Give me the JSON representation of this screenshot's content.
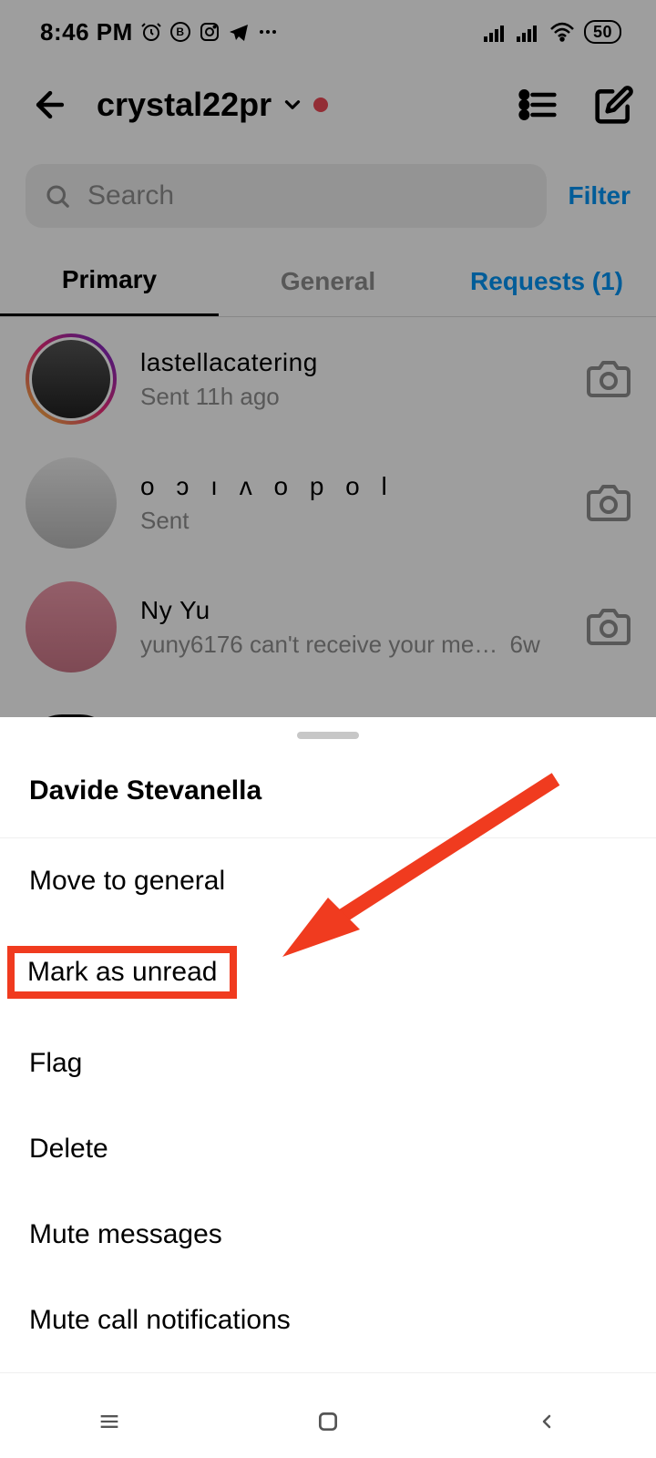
{
  "status": {
    "time": "8:46 PM",
    "battery": "50"
  },
  "header": {
    "username": "crystal22pr"
  },
  "search": {
    "placeholder": "Search",
    "filter_label": "Filter"
  },
  "tabs": {
    "primary": "Primary",
    "general": "General",
    "requests": "Requests (1)"
  },
  "conversations": [
    {
      "name": "lastellacatering",
      "subtitle": "Sent 11h ago",
      "time": "",
      "story_ring": true
    },
    {
      "name": "o ɔ ı ʌ o p o l",
      "subtitle": "Sent",
      "time": "",
      "story_ring": false
    },
    {
      "name": "Ny Yu",
      "subtitle": "yuny6176 can't receive your me…",
      "time": "6w",
      "story_ring": false
    }
  ],
  "sheet": {
    "title": "Davide Stevanella",
    "items": {
      "move": "Move to general",
      "mark_unread": "Mark as unread",
      "flag": "Flag",
      "delete": "Delete",
      "mute_messages": "Mute messages",
      "mute_calls": "Mute call notifications"
    }
  }
}
